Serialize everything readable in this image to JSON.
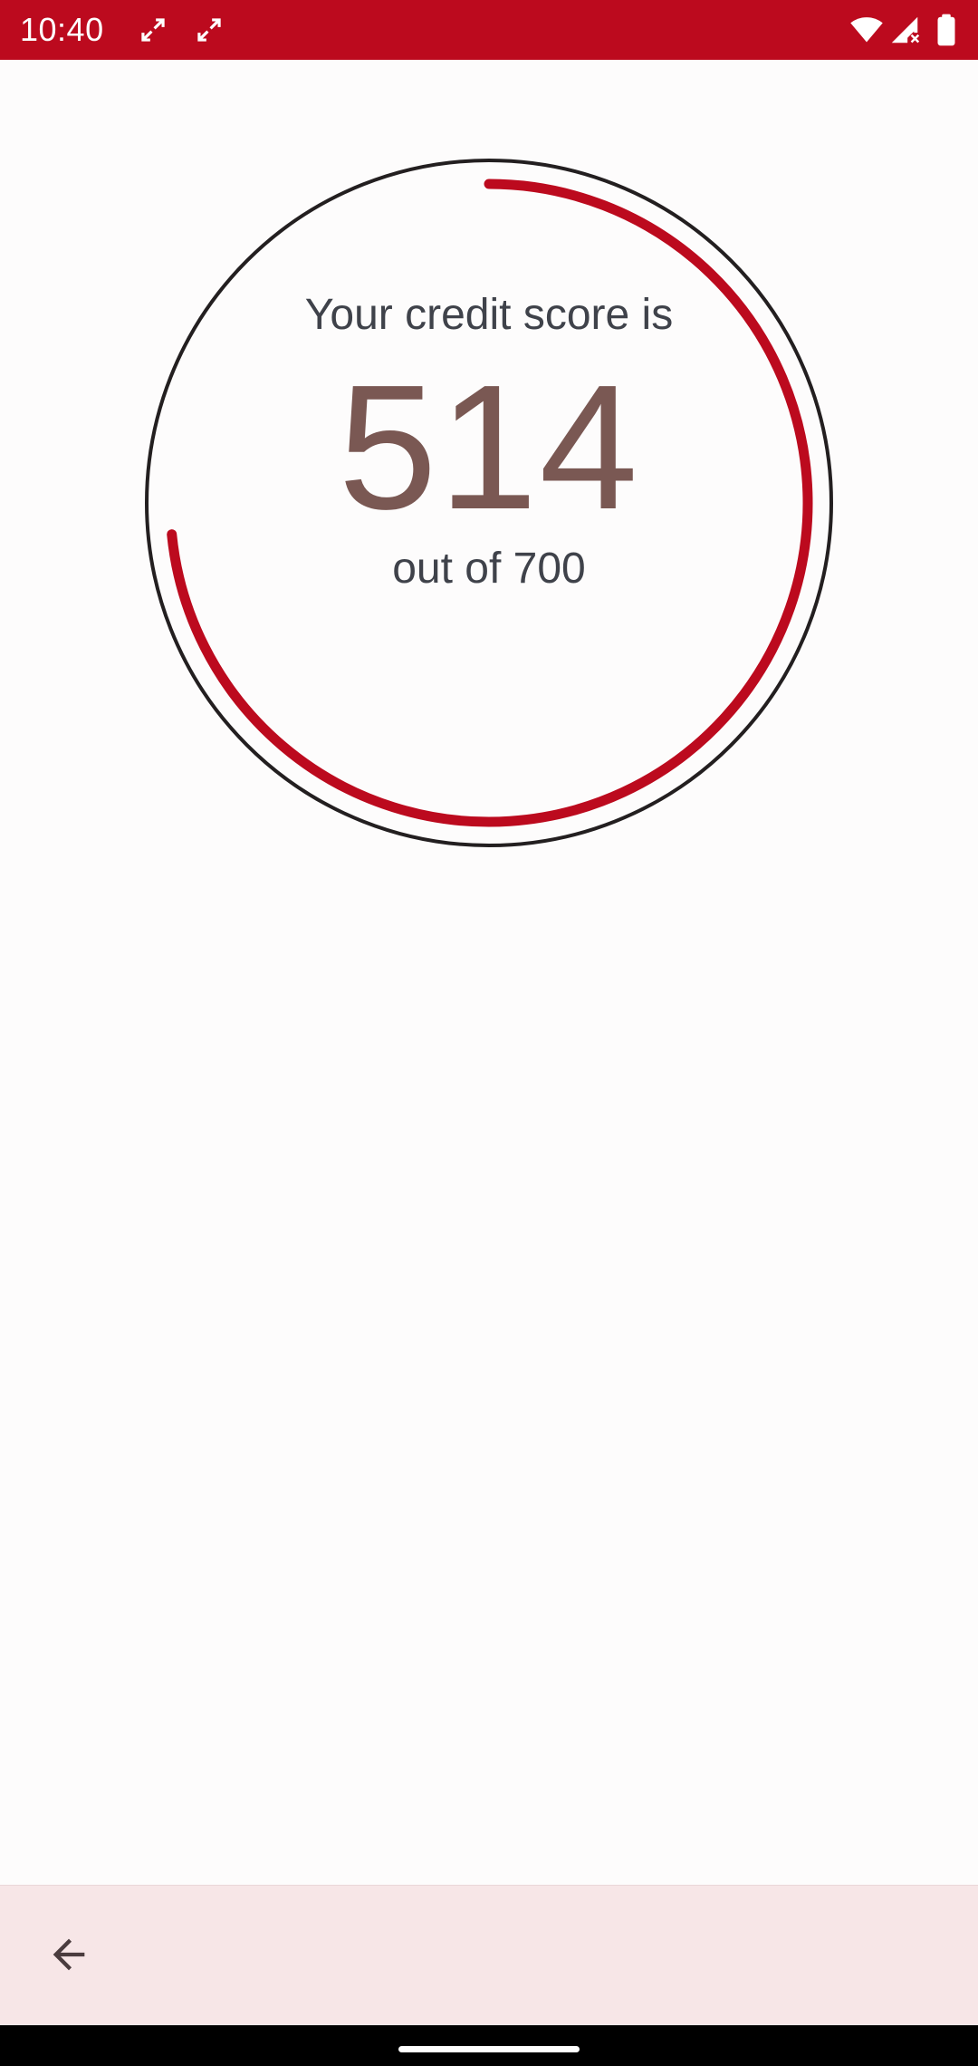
{
  "status_bar": {
    "time": "10:40",
    "background_color": "#BC0A1E",
    "icons": [
      "expand-arrows-icon",
      "expand-arrows-icon",
      "wifi-icon",
      "signal-no-data-icon",
      "battery-icon"
    ]
  },
  "credit_score": {
    "caption": "Your credit score is",
    "score": "514",
    "max_label": "out of 700",
    "score_value": 514,
    "score_max": 700,
    "progress_fraction": 0.7343,
    "progress_color": "#BC0A1E",
    "ring_color": "#231F20",
    "score_color": "#7A5853"
  },
  "bottom_bar": {
    "back_icon": "arrow-left-icon",
    "background_color": "#F7E6E7"
  },
  "system_nav": {
    "home_indicator": "home-indicator"
  }
}
